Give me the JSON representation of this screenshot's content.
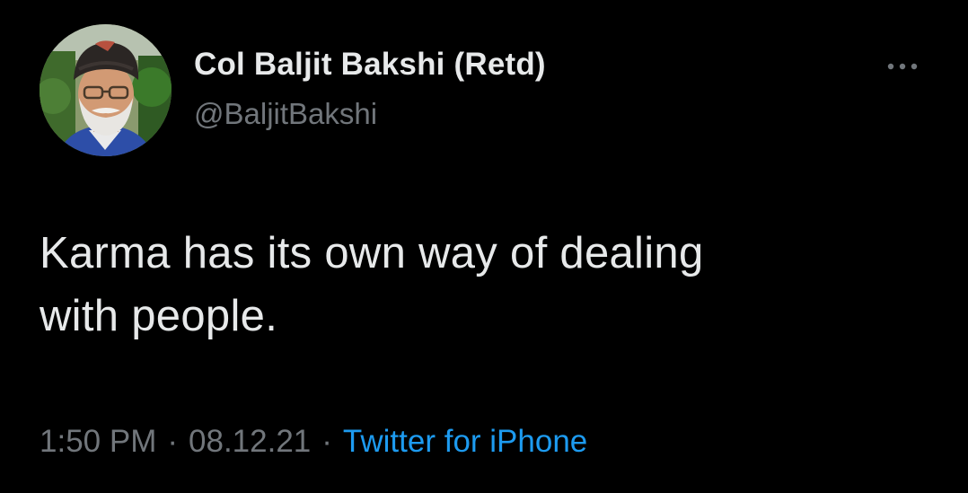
{
  "tweet": {
    "author": {
      "display_name": "Col Baljit Bakshi (Retd)",
      "handle": "@BaljitBakshi",
      "avatar_icon": "profile-photo"
    },
    "text_line1": "Karma has its own way of dealing",
    "text_line2": "with people.",
    "time": "1:50 PM",
    "date": "08.12.21",
    "separator": "·",
    "source": "Twitter for iPhone",
    "more_icon": "ellipsis-icon"
  },
  "colors": {
    "background": "#000000",
    "primary_text": "#e7e9ea",
    "secondary_text": "#71767b",
    "link": "#1d9bf0"
  }
}
